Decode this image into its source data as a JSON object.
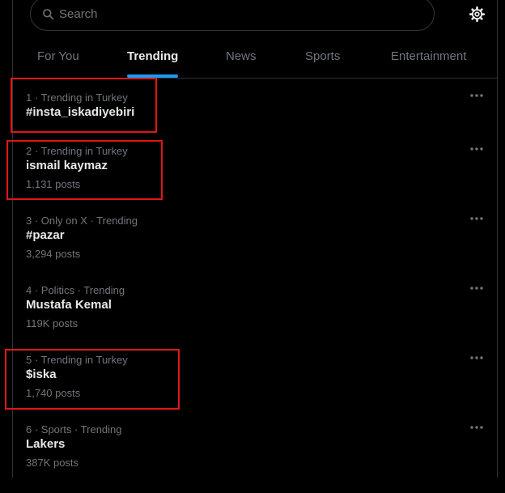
{
  "search": {
    "placeholder": "Search"
  },
  "tabs": [
    {
      "label": "For You",
      "active": false
    },
    {
      "label": "Trending",
      "active": true
    },
    {
      "label": "News",
      "active": false
    },
    {
      "label": "Sports",
      "active": false
    },
    {
      "label": "Entertainment",
      "active": false
    }
  ],
  "trends": [
    {
      "meta": "1 · Trending in Turkey",
      "name": "#insta_iskadiyebiri",
      "posts": ""
    },
    {
      "meta": "2 · Trending in Turkey",
      "name": "ismail kaymaz",
      "posts": "1,131 posts"
    },
    {
      "meta": "3 · Only on X · Trending",
      "name": "#pazar",
      "posts": "3,294 posts"
    },
    {
      "meta": "4 · Politics · Trending",
      "name": "Mustafa Kemal",
      "posts": "119K posts"
    },
    {
      "meta": "5 · Trending in Turkey",
      "name": "$iska",
      "posts": "1,740 posts"
    },
    {
      "meta": "6 · Sports · Trending",
      "name": "Lakers",
      "posts": "387K posts"
    }
  ],
  "icons": {
    "search": "search-icon",
    "settings": "gear-icon",
    "more": "more-icon"
  },
  "colors": {
    "background": "#000000",
    "accent": "#1d9bf0",
    "highlight": "#e31515",
    "muted": "#71767b"
  }
}
